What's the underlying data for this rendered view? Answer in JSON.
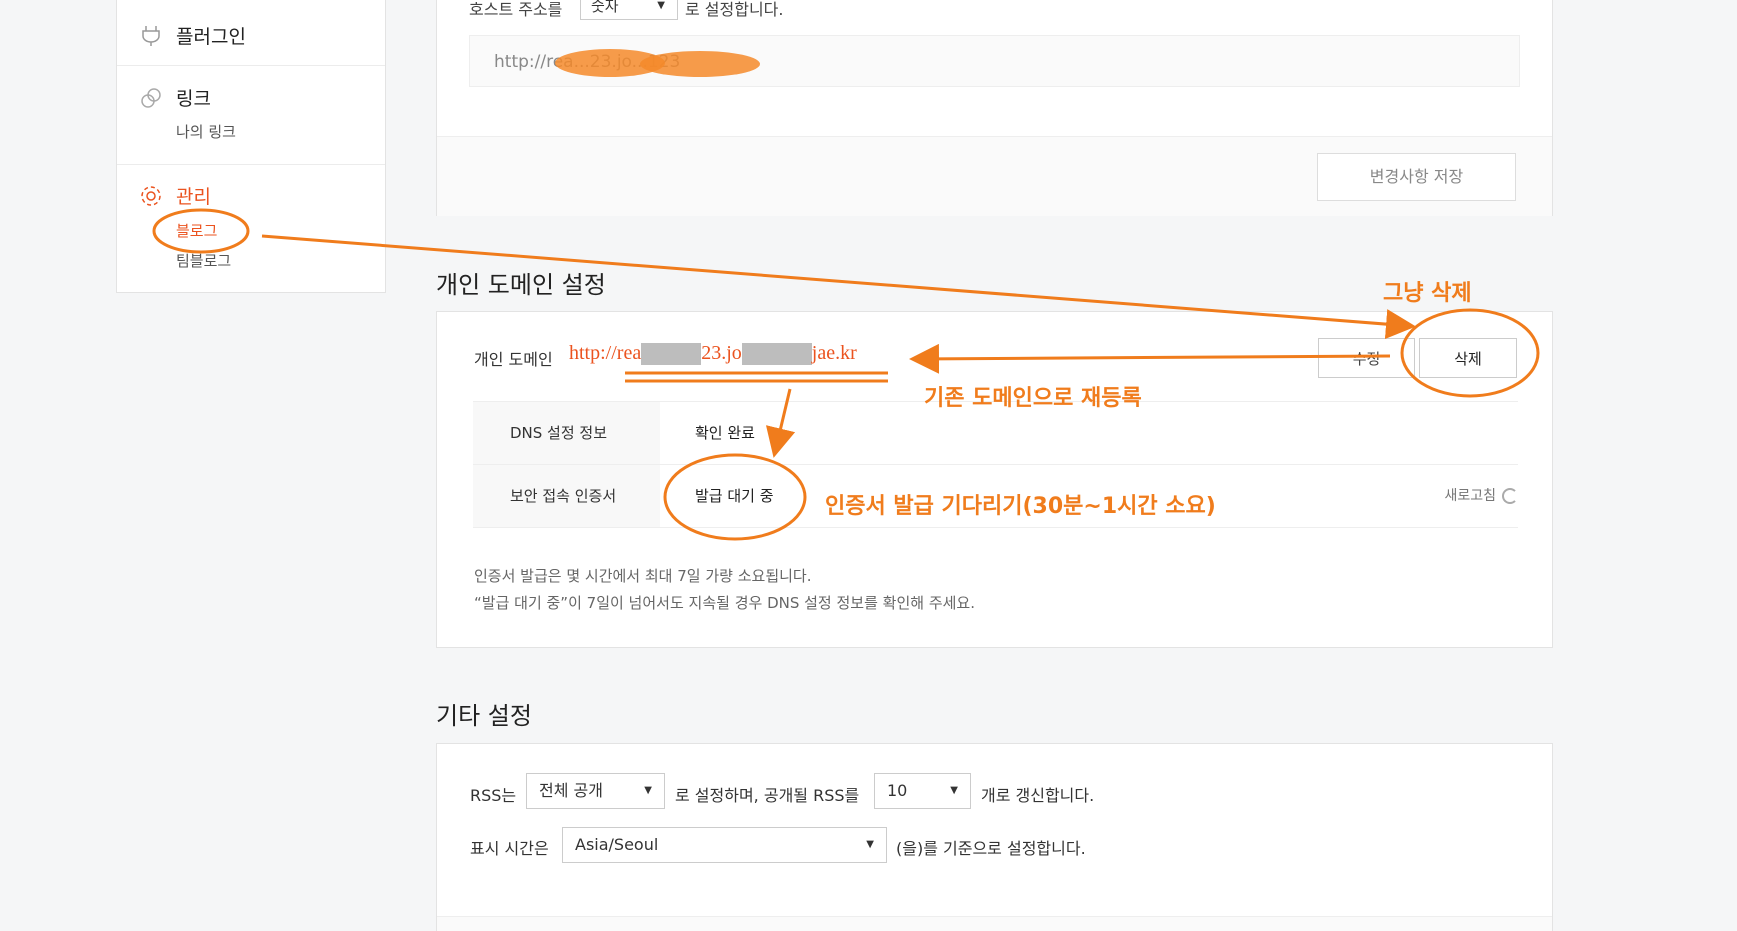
{
  "sidebar": {
    "plugin": {
      "title": "플러그인",
      "icon": "plug-icon"
    },
    "link": {
      "title": "링크",
      "icon": "link-icon",
      "sub": "나의 링크"
    },
    "manage": {
      "title": "관리",
      "icon": "gear-icon",
      "items": [
        "블로그",
        "팀블로그"
      ]
    }
  },
  "host_panel": {
    "prefix": "호스트 주소를",
    "select_value": "숫자",
    "suffix": "로 설정합니다.",
    "url": "http://rea...23.jo...123",
    "save_label": "변경사항 저장"
  },
  "domain_section": {
    "heading": "개인 도메인 설정",
    "label": "개인 도메인",
    "url_prefix": "http://rea",
    "url_mid": "23.jo",
    "url_suffix": "jae.kr",
    "edit_label": "수정",
    "delete_label": "삭제",
    "rows": [
      {
        "key": "DNS 설정 정보",
        "value": "확인 완료"
      },
      {
        "key": "보안 접속 인증서",
        "value": "발급 대기 중"
      }
    ],
    "refresh_label": "새로고침",
    "notes": [
      "인증서 발급은 몇 시간에서 최대 7일 가량 소요됩니다.",
      "“발급 대기 중”이 7일이 넘어서도 지속될 경우 DNS 설정 정보를 확인해 주세요."
    ]
  },
  "other_section": {
    "heading": "기타 설정",
    "rss_prefix": "RSS는",
    "rss_select": "전체 공개",
    "rss_mid": "로 설정하며, 공개될 RSS를",
    "rss_count": "10",
    "rss_suffix": "개로 갱신합니다.",
    "time_prefix": "표시 시간은",
    "time_select": "Asia/Seoul",
    "time_suffix": "(을)를 기준으로 설정합니다."
  },
  "annotations": {
    "just_delete": "그냥 삭제",
    "reregister": "기존 도메인으로 재등록",
    "wait_cert": "인증서 발급 기다리기(30분~1시간 소요)",
    "color": "#f07c1c"
  }
}
